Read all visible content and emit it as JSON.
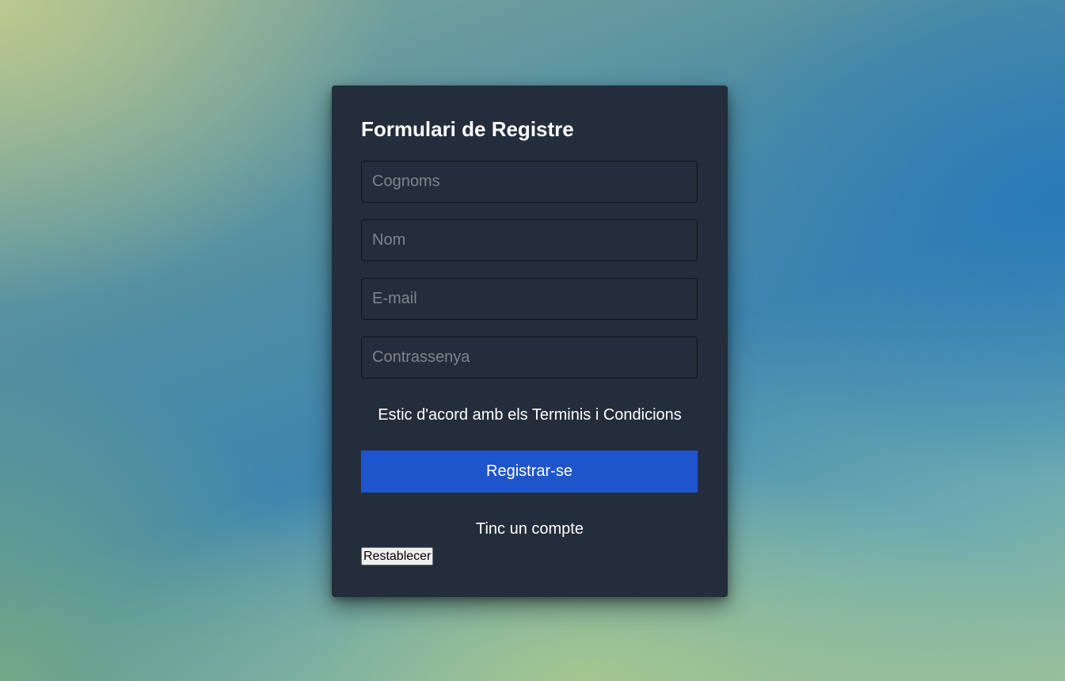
{
  "form": {
    "title": "Formulari de Registre",
    "fields": [
      {
        "placeholder": "Cognoms",
        "value": ""
      },
      {
        "placeholder": "Nom",
        "value": ""
      },
      {
        "placeholder": "E-mail",
        "value": ""
      },
      {
        "placeholder": "Contrassenya",
        "value": ""
      }
    ],
    "terms_label": "Estic d'acord amb els Terminis i Condicions",
    "submit_label": "Registrar-se",
    "login_label": "Tinc un compte",
    "reset_label": "Restablecer"
  },
  "colors": {
    "card_background": "#232d3b",
    "submit_background": "#1f55cc",
    "text": "#ffffff",
    "placeholder": "#7d858f"
  }
}
